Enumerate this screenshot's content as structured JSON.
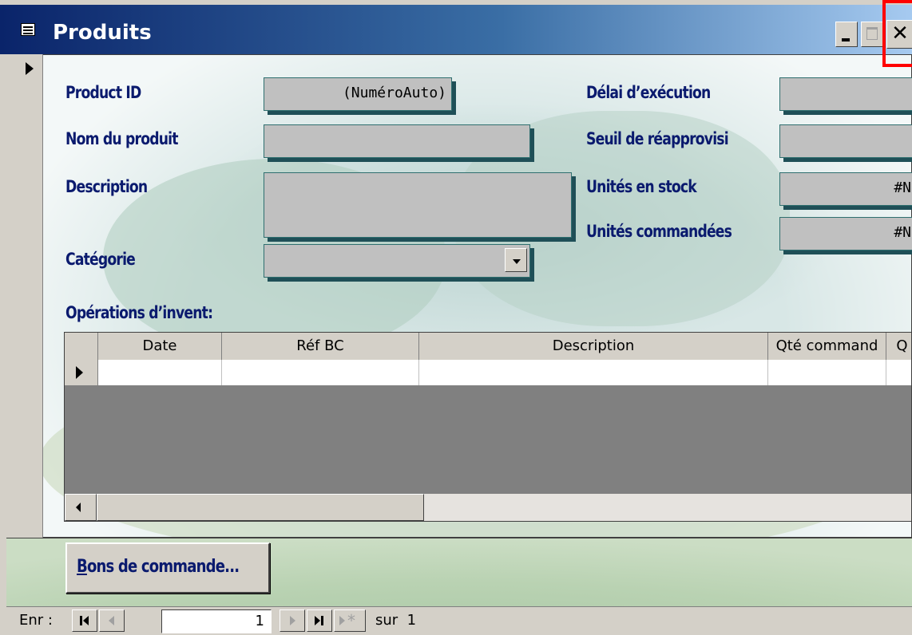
{
  "window": {
    "title": "Produits"
  },
  "fields": {
    "product_id": {
      "label": "Product ID",
      "value": "(NuméroAuto)"
    },
    "product_name": {
      "label": "Nom du produit",
      "value": ""
    },
    "description": {
      "label": "Description",
      "value": ""
    },
    "category": {
      "label": "Catégorie",
      "value": ""
    },
    "lead_time": {
      "label": "Délai d’exécution",
      "value": ""
    },
    "reorder_level": {
      "label": "Seuil de réapprovisi",
      "value": ""
    },
    "units_in_stock": {
      "label": "Unités en stock",
      "value": "#N"
    },
    "units_on_order": {
      "label": "Unités commandées",
      "value": "#N"
    }
  },
  "subform": {
    "label": "Opérations d’invent:",
    "columns": [
      "Date",
      "Réf BC",
      "Description",
      "Qté command",
      "Q"
    ]
  },
  "purchase_orders_button": {
    "label_first": "B",
    "label_rest": "ons de commande..."
  },
  "navigation": {
    "label": "Enr :",
    "current_record": "1",
    "of_label": "sur",
    "total": "1"
  },
  "colors": {
    "label_text": "#0a1a6e",
    "field_bg": "#c0c0c0",
    "highlight_box": "#ff0000"
  }
}
